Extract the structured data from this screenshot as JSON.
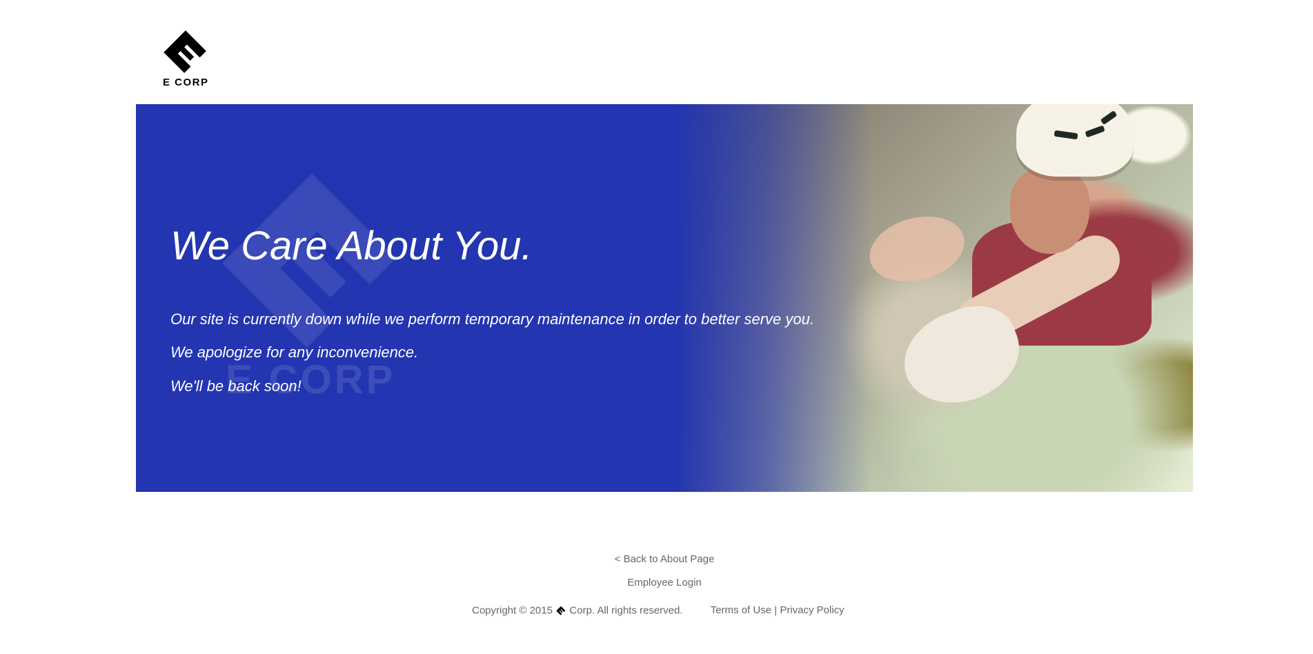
{
  "header": {
    "logo_text": "E  CORP"
  },
  "hero": {
    "watermark_text": "E CORP",
    "title": "We Care About You.",
    "lines": [
      "Our site is currently down while we perform temporary maintenance in order to better serve you.",
      "We apologize for any inconvenience.",
      "We'll be back soon!"
    ]
  },
  "footer": {
    "back_link": "< Back to About Page",
    "login_link": "Employee Login",
    "copyright_prefix": "Copyright © 2015",
    "copyright_suffix": "Corp. All rights reserved.",
    "terms_link": "Terms of Use",
    "separator": "|",
    "privacy_link": "Privacy Policy"
  },
  "colors": {
    "hero_background": "#2335b0",
    "footer_text": "#666666"
  }
}
